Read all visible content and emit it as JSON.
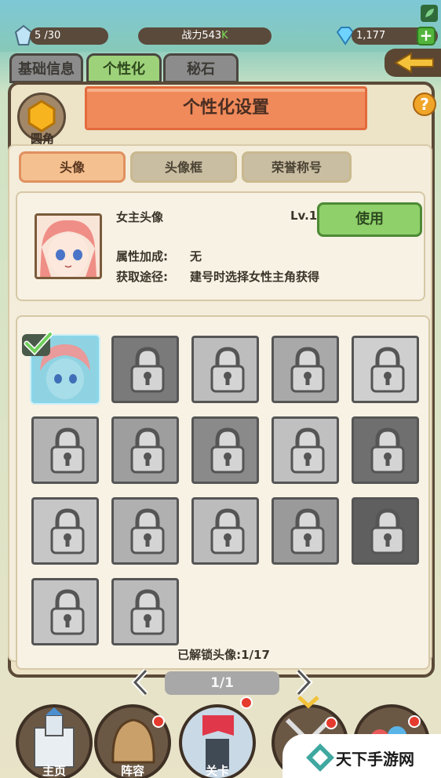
{
  "topbar": {
    "energy": "5 /30",
    "power_label": "战力",
    "power_value": "543",
    "power_suffix": "K",
    "gems": "1,177"
  },
  "tabs": [
    {
      "label": "基础信息",
      "active": false
    },
    {
      "label": "个性化",
      "active": true
    },
    {
      "label": "秘石",
      "active": false
    }
  ],
  "header": {
    "title": "个性化设置",
    "badge_label": "圆角",
    "help": "?"
  },
  "subtabs": [
    {
      "label": "头像",
      "active": true
    },
    {
      "label": "头像框",
      "active": false
    },
    {
      "label": "荣誉称号",
      "active": false
    }
  ],
  "detail": {
    "name": "女主头像",
    "level": "Lv.1",
    "use_label": "使用",
    "attr_label": "属性加成:",
    "attr_value": "无",
    "source_label": "获取途径:",
    "source_value": "建号时选择女性主角获得"
  },
  "avatars": {
    "total": 17,
    "unlocked_index": 0
  },
  "footer": {
    "unlock_count": "已解锁头像:1/17",
    "page": "1/1"
  },
  "bottom_nav": [
    {
      "label": "主页"
    },
    {
      "label": "阵容"
    },
    {
      "label": "关卡"
    },
    {
      "label": ""
    },
    {
      "label": ""
    }
  ],
  "watermark": "天下手游网"
}
